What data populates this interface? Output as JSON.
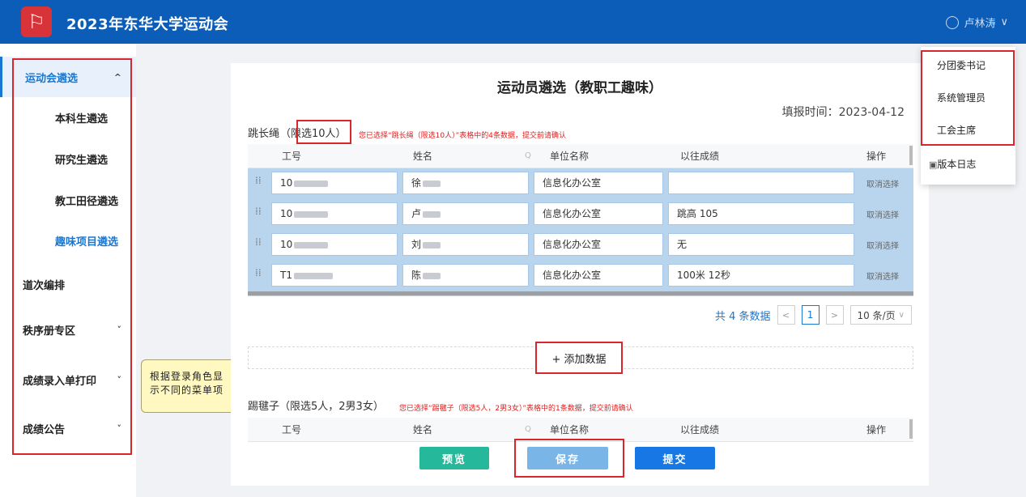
{
  "header": {
    "logo_glyph": "⚐",
    "title": "2023年东华大学运动会",
    "user_name": "卢林涛",
    "user_chevron": "∨"
  },
  "sidebar": {
    "items": [
      {
        "label": "运动会遴选",
        "chevron": "^"
      },
      {
        "label": "本科生遴选"
      },
      {
        "label": "研究生遴选"
      },
      {
        "label": "教工田径遴选"
      },
      {
        "label": "趣味项目遴选"
      },
      {
        "label": "道次编排"
      },
      {
        "label": "秩序册专区",
        "chevron": "˅"
      },
      {
        "label": "成绩录入单打印",
        "chevron": "˅"
      },
      {
        "label": "成绩公告",
        "chevron": "˅"
      }
    ]
  },
  "tooltip": {
    "text": "根据登录角色显示不同的菜单项"
  },
  "main": {
    "title": "运动员遴选（教职工趣味）",
    "report_time": "填报时间：2023-04-12",
    "section1": {
      "name": "跳长绳",
      "limit": "（限选10人）",
      "note": "您已选择“跳长绳（限选10人）”表格中的4条数据，提交前请确认",
      "headers": [
        "工号",
        "姓名",
        "单位名称",
        "以往成绩",
        "操作"
      ],
      "search_glyph": "Q",
      "rows": [
        {
          "id": "10",
          "name": "徐",
          "unit": "信息化办公室",
          "score": "",
          "action": "取消选择"
        },
        {
          "id": "10",
          "name": "卢",
          "unit": "信息化办公室",
          "score": "跳高 105",
          "action": "取消选择"
        },
        {
          "id": "10",
          "name": "刘",
          "unit": "信息化办公室",
          "score": "无",
          "action": "取消选择"
        },
        {
          "id": "T1",
          "name": "陈",
          "unit": "信息化办公室",
          "score": "100米 12秒",
          "action": "取消选择"
        }
      ],
      "drag_glyph": "⁞⁞"
    },
    "pagination": {
      "total": "共 4 条数据",
      "prev": "<",
      "page": "1",
      "next": ">",
      "page_size": "10 条/页",
      "size_chevron": "∨"
    },
    "add_button": "+ 添加数据",
    "section2": {
      "name": "踢毽子（限选5人，2男3女）",
      "note": "您已选择“踢毽子（限选5人，2男3女）”表格中的1条数据，提交前请确认",
      "headers": [
        "工号",
        "姓名",
        "单位名称",
        "以往成绩",
        "操作"
      ]
    },
    "buttons": {
      "preview": "预览",
      "save": "保存",
      "submit": "提交"
    },
    "colors": {
      "preview": "#26b89a",
      "save": "#7ab5e8",
      "submit": "#1677e5"
    }
  },
  "dropdown": {
    "roles": [
      "分团委书记",
      "系统管理员",
      "工会主席"
    ],
    "log": "版本日志",
    "log_glyph": "▣"
  }
}
